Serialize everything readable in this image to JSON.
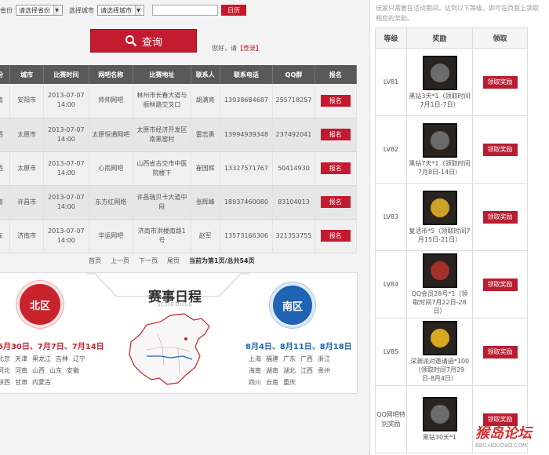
{
  "filter": {
    "province_label": "省份",
    "province_value": "请选择省份",
    "city_label": "选择城市",
    "city_value": "请选择城市",
    "date_value": "",
    "calendar_label": "日历"
  },
  "search": {
    "label": "查询"
  },
  "greeting": {
    "prefix": "您好，请",
    "login": "【登录】"
  },
  "table": {
    "headers": [
      "份",
      "城市",
      "比赛时间",
      "网吧名称",
      "比赛地址",
      "联系人",
      "联系电话",
      "QQ群",
      "报名"
    ],
    "rows": [
      {
        "prov": "南",
        "city": "安阳市",
        "date": "2013-07-07",
        "time": "14:00",
        "cafe": "帅帅网吧",
        "addr": "林州市长春大道与振林路交叉口",
        "contact": "胡满亮",
        "phone": "13938684687",
        "qq": "255718257"
      },
      {
        "prov": "西",
        "city": "太原市",
        "date": "2013-07-07",
        "time": "14:00",
        "cafe": "太原恒通网吧",
        "addr": "太原市经济开发区南黑窑村",
        "contact": "雷志勇",
        "phone": "13994939348",
        "qq": "237492041"
      },
      {
        "prov": "西",
        "city": "太原市",
        "date": "2013-07-07",
        "time": "14:00",
        "cafe": "心雨网吧",
        "addr": "山西省古交市中医院楼下",
        "contact": "崔国辉",
        "phone": "13327571767",
        "qq": "50414930"
      },
      {
        "prov": "南",
        "city": "许昌市",
        "date": "2013-07-07",
        "time": "14:00",
        "cafe": "东方红网络",
        "addr": "许昌瑞贝卡大道中段",
        "contact": "张辉峰",
        "phone": "18937460080",
        "qq": "83104013"
      },
      {
        "prov": "东",
        "city": "济南市",
        "date": "2013-07-07",
        "time": "14:00",
        "cafe": "华运网吧",
        "addr": "济南市洪楼南路1号",
        "contact": "赵军",
        "phone": "13573166306",
        "qq": "321353755"
      }
    ],
    "register_label": "报名"
  },
  "pager": {
    "first": "首页",
    "prev": "上一页",
    "next": "下一页",
    "last": "尾页",
    "status": "当前为第1页/总共54页"
  },
  "schedule": {
    "title": "赛事日程",
    "subtitle": "SCHEDULE",
    "north_label": "北区",
    "south_label": "南区",
    "north_dates": "6月30日、7月7日、7月14日",
    "south_dates": "8月4日、8月11日、8月18日",
    "north_cities": [
      "北京",
      "天津",
      "黑龙江",
      "吉林",
      "辽宁",
      "河北",
      "河南",
      "山西",
      "山东",
      "安徽",
      "陕西",
      "甘肃",
      "内蒙古"
    ],
    "south_cities": [
      "上海",
      "福建",
      "广东",
      "广西",
      "浙江",
      "海南",
      "湖南",
      "湖北",
      "江西",
      "贵州",
      "四川",
      "云南",
      "重庆"
    ]
  },
  "rewards": {
    "note": "玩家只需要在活动期间，达到以下等级，即可在页面上领取相应的奖励。",
    "headers": [
      "等级",
      "奖励",
      "领取"
    ],
    "claim_label": "领取奖励",
    "rows": [
      {
        "level": "LV81",
        "reward": "黑钻3天*1（领取时间7月1日-7日）",
        "color": "#6b6b6b"
      },
      {
        "level": "LV82",
        "reward": "黑钻7天*1（领取时间7月8日-14日）",
        "color": "#6b6b6b"
      },
      {
        "level": "LV83",
        "reward": "复活币*5（领取时间7月15日-21日）",
        "color": "#c9a227"
      },
      {
        "level": "LV84",
        "reward": "QQ会员28号*1（领取时间7月22日-28日）",
        "color": "#a4302a"
      },
      {
        "level": "LV85",
        "reward": "深渊派对邀请函*100（领取时间7月29日-8月4日）",
        "color": "#d8a720"
      },
      {
        "level": "QQ网吧特别奖励",
        "reward": "黑钻30天*1",
        "color": "#6b6b6b"
      }
    ]
  },
  "watermark": {
    "main": "猴岛论坛",
    "sub": "BBS.HOUDAO.COM"
  },
  "colors": {
    "accent": "#c51b30",
    "north": "#c8232c",
    "south": "#1f63b5",
    "header": "#595959"
  }
}
